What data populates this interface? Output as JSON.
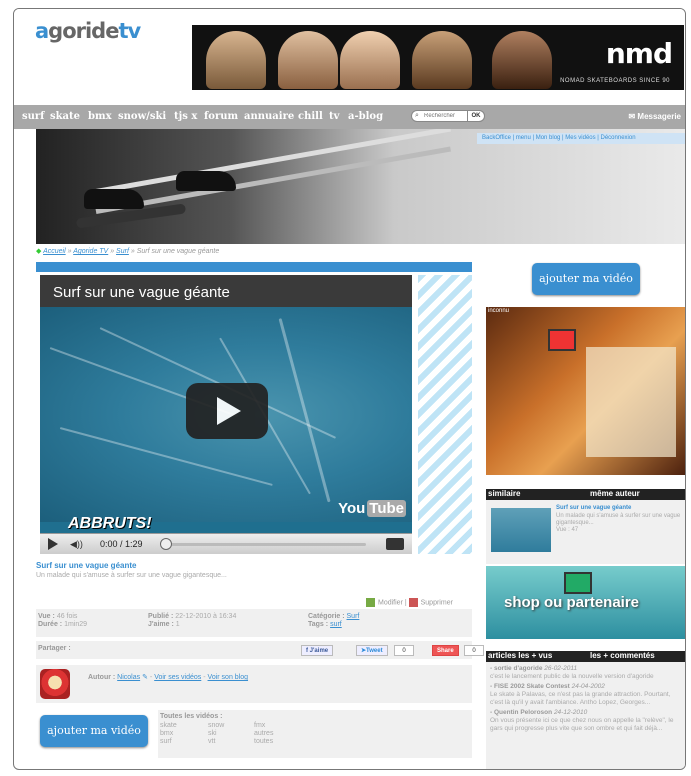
{
  "header": {
    "logo_prefix": "a",
    "logo_main": "goride",
    "logo_suffix": "tv"
  },
  "ad": {
    "brand": "nmd",
    "tagline": "NOMAD SKATEBOARDS SINCE 90"
  },
  "nav": {
    "items": [
      "surf",
      "skate",
      "bmx",
      "snow/ski",
      "tjs x",
      "forum",
      "annuaire",
      "chill",
      "tv",
      "a-blog"
    ],
    "search_placeholder": "Rechercher",
    "search_button": "OK",
    "messages": "Messagerie"
  },
  "userbar": "BackOffice | menu | Mon blog | Mes vidéos | Déconnexion",
  "breadcrumb": {
    "home_icon": "◆",
    "home": "Accueil",
    "sep": "»",
    "section": "Agoride TV",
    "category": "Surf",
    "current": "Surf sur une vague géante"
  },
  "video": {
    "title": "Surf sur une vague géante",
    "overlay_text": "ABBRUTS!",
    "yt_you": "You",
    "yt_tube": "Tube",
    "time": "0:00 / 1:29",
    "volume_icon": "◀))"
  },
  "details": {
    "title": "Surf sur une vague géante",
    "description": "Un malade qui s'amuse à surfer sur une vague gigantesque...",
    "modify": "Modifier",
    "delete": "Supprimer",
    "vue_label": "Vue :",
    "vue_value": "46 fois",
    "duree_label": "Durée :",
    "duree_value": "1min29",
    "publie_label": "Publié :",
    "publie_value": "22-12-2010 à 16:34",
    "jaime_label": "J'aime :",
    "jaime_value": "1",
    "categorie_label": "Catégorie :",
    "categorie_value": "Surf",
    "tags_label": "Tags :",
    "tags_value": "surf"
  },
  "share": {
    "label": "Partager :",
    "fb": "J'aime",
    "tweet": "Tweet",
    "tweet_count": "0",
    "share": "Share",
    "share_count": "0"
  },
  "author": {
    "label": "Autour :",
    "name": "Nicolas",
    "see_videos": "Voir ses vidéos",
    "see_blog": "Voir son blog",
    "sep": "-"
  },
  "buttons": {
    "add_video": "ajouter ma vidéo"
  },
  "all_videos": {
    "heading": "Toutes les vidéos :",
    "col1": [
      "skate",
      "bmx",
      "surf"
    ],
    "col2": [
      "snow",
      "ski",
      "vtt"
    ],
    "col3": [
      "fmx",
      "autres",
      "toutes"
    ]
  },
  "right": {
    "img_label": "inconnu",
    "tab_similar": "similaire",
    "tab_author": "même auteur",
    "similar_title": "Surf sur une vague géante",
    "similar_desc": "Un malade qui s'amuse à surfer sur une vague gigantesque...",
    "similar_views": "Vue : 47",
    "shop": "shop ou partenaire",
    "tab_articles": "articles les + vus",
    "tab_comments": "les + commentés",
    "articles": [
      {
        "title": "- sortie d'agoride",
        "date": "26-02-2011",
        "desc": "c'est le lancement public de la nouvelle version d'agoride"
      },
      {
        "title": "- FISE 2002 Skate Contest",
        "date": "24-04-2002",
        "desc": "Le skate à Palavas, ce n'est pas la grande attraction. Pourtant, c'est là qu'il y avait l'ambiance. Antho Lopez, Georges..."
      },
      {
        "title": "- Quentin Peloroson",
        "date": "24-12-2010",
        "desc": "On vous présente ici ce que chez nous on appelle la \"relève\", le gars qui progresse plus vite que son ombre et qui fait déjà..."
      }
    ]
  }
}
